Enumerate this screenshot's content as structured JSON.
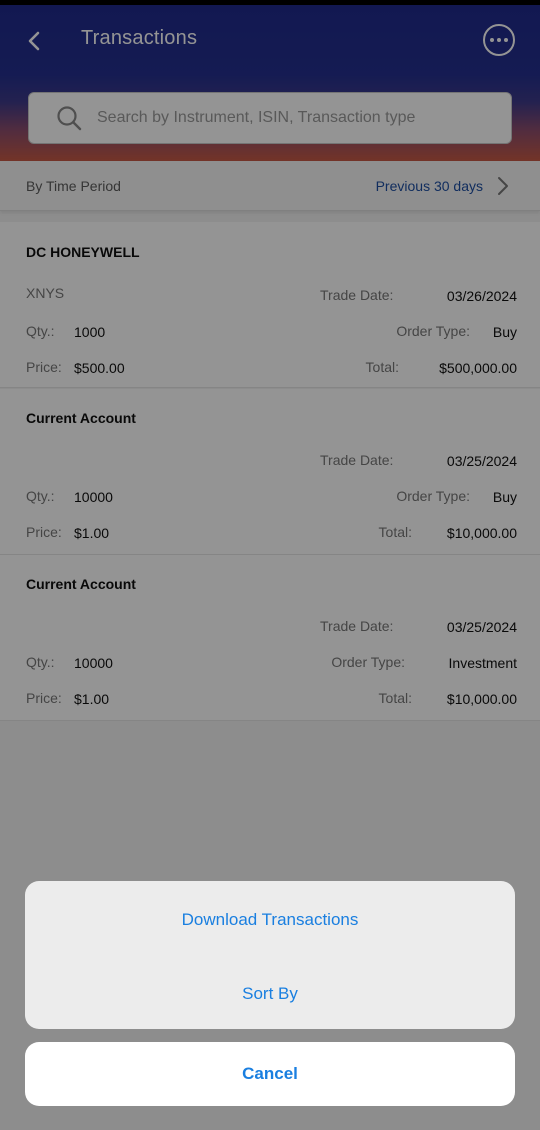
{
  "header": {
    "title": "Transactions",
    "search_placeholder": "Search by Instrument, ISIN, Transaction type"
  },
  "filter": {
    "label": "By Time Period",
    "value": "Previous 30 days"
  },
  "labels": {
    "trade_date": "Trade Date:",
    "qty": "Qty.:",
    "order_type": "Order Type:",
    "price": "Price:",
    "total": "Total:"
  },
  "transactions": [
    {
      "name": "DC HONEYWELL",
      "exchange": "XNYS",
      "trade_date": "03/26/2024",
      "qty": "1000",
      "order_type": "Buy",
      "price": "$500.00",
      "total": "$500,000.00"
    },
    {
      "name": "Current Account",
      "exchange": "",
      "trade_date": "03/25/2024",
      "qty": "10000",
      "order_type": "Buy",
      "price": "$1.00",
      "total": "$10,000.00"
    },
    {
      "name": "Current Account",
      "exchange": "",
      "trade_date": "03/25/2024",
      "qty": "10000",
      "order_type": "Investment",
      "price": "$1.00",
      "total": "$10,000.00"
    }
  ],
  "action_sheet": {
    "download": "Download Transactions",
    "sort": "Sort By",
    "cancel": "Cancel"
  },
  "colors": {
    "header_top": "#202a8c",
    "header_bottom": "#c75a45",
    "link": "#1e4fa3",
    "action": "#1a7fe0"
  }
}
